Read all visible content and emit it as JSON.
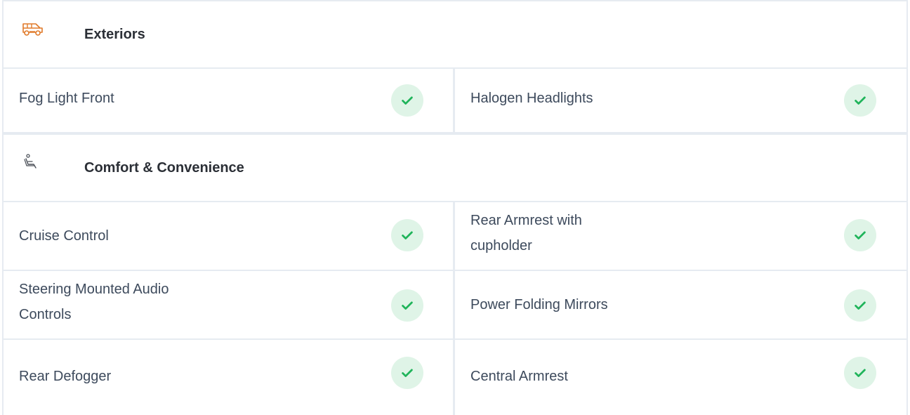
{
  "colors": {
    "border": "#e6ebf1",
    "check_bg": "#dff4e7",
    "check_mark": "#1fb45a",
    "car_icon": "#e07a2a",
    "seat_icon": "#4a4f57"
  },
  "sections": [
    {
      "icon": "car-icon",
      "title": "Exteriors",
      "rows": [
        {
          "left": "Fog Light Front",
          "right": "Halogen Headlights"
        }
      ]
    },
    {
      "icon": "seat-icon",
      "title": "Comfort & Convenience",
      "rows": [
        {
          "left": "Cruise Control",
          "right": "Rear Armrest with cupholder"
        },
        {
          "left": "Steering Mounted Audio Controls",
          "right": "Power Folding Mirrors"
        },
        {
          "left": "Rear Defogger",
          "right": "Central Armrest"
        }
      ]
    }
  ]
}
